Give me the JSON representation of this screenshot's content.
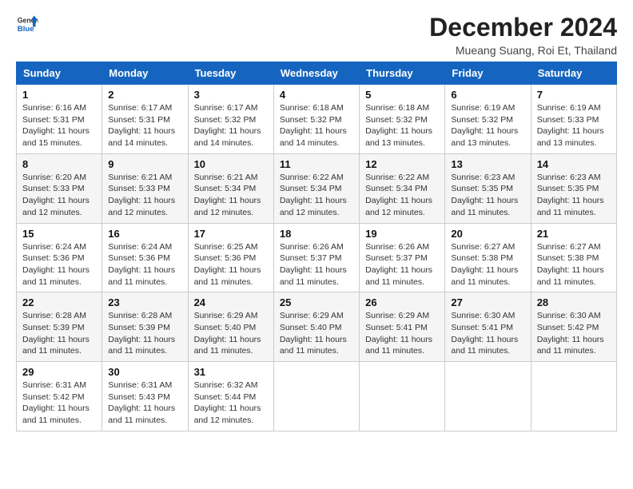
{
  "header": {
    "logo_general": "General",
    "logo_blue": "Blue",
    "title": "December 2024",
    "location": "Mueang Suang, Roi Et, Thailand"
  },
  "calendar": {
    "headers": [
      "Sunday",
      "Monday",
      "Tuesday",
      "Wednesday",
      "Thursday",
      "Friday",
      "Saturday"
    ],
    "weeks": [
      [
        {
          "day": "1",
          "sunrise": "6:16 AM",
          "sunset": "5:31 PM",
          "daylight": "11 hours and 15 minutes."
        },
        {
          "day": "2",
          "sunrise": "6:17 AM",
          "sunset": "5:31 PM",
          "daylight": "11 hours and 14 minutes."
        },
        {
          "day": "3",
          "sunrise": "6:17 AM",
          "sunset": "5:32 PM",
          "daylight": "11 hours and 14 minutes."
        },
        {
          "day": "4",
          "sunrise": "6:18 AM",
          "sunset": "5:32 PM",
          "daylight": "11 hours and 14 minutes."
        },
        {
          "day": "5",
          "sunrise": "6:18 AM",
          "sunset": "5:32 PM",
          "daylight": "11 hours and 13 minutes."
        },
        {
          "day": "6",
          "sunrise": "6:19 AM",
          "sunset": "5:32 PM",
          "daylight": "11 hours and 13 minutes."
        },
        {
          "day": "7",
          "sunrise": "6:19 AM",
          "sunset": "5:33 PM",
          "daylight": "11 hours and 13 minutes."
        }
      ],
      [
        {
          "day": "8",
          "sunrise": "6:20 AM",
          "sunset": "5:33 PM",
          "daylight": "11 hours and 12 minutes."
        },
        {
          "day": "9",
          "sunrise": "6:21 AM",
          "sunset": "5:33 PM",
          "daylight": "11 hours and 12 minutes."
        },
        {
          "day": "10",
          "sunrise": "6:21 AM",
          "sunset": "5:34 PM",
          "daylight": "11 hours and 12 minutes."
        },
        {
          "day": "11",
          "sunrise": "6:22 AM",
          "sunset": "5:34 PM",
          "daylight": "11 hours and 12 minutes."
        },
        {
          "day": "12",
          "sunrise": "6:22 AM",
          "sunset": "5:34 PM",
          "daylight": "11 hours and 12 minutes."
        },
        {
          "day": "13",
          "sunrise": "6:23 AM",
          "sunset": "5:35 PM",
          "daylight": "11 hours and 11 minutes."
        },
        {
          "day": "14",
          "sunrise": "6:23 AM",
          "sunset": "5:35 PM",
          "daylight": "11 hours and 11 minutes."
        }
      ],
      [
        {
          "day": "15",
          "sunrise": "6:24 AM",
          "sunset": "5:36 PM",
          "daylight": "11 hours and 11 minutes."
        },
        {
          "day": "16",
          "sunrise": "6:24 AM",
          "sunset": "5:36 PM",
          "daylight": "11 hours and 11 minutes."
        },
        {
          "day": "17",
          "sunrise": "6:25 AM",
          "sunset": "5:36 PM",
          "daylight": "11 hours and 11 minutes."
        },
        {
          "day": "18",
          "sunrise": "6:26 AM",
          "sunset": "5:37 PM",
          "daylight": "11 hours and 11 minutes."
        },
        {
          "day": "19",
          "sunrise": "6:26 AM",
          "sunset": "5:37 PM",
          "daylight": "11 hours and 11 minutes."
        },
        {
          "day": "20",
          "sunrise": "6:27 AM",
          "sunset": "5:38 PM",
          "daylight": "11 hours and 11 minutes."
        },
        {
          "day": "21",
          "sunrise": "6:27 AM",
          "sunset": "5:38 PM",
          "daylight": "11 hours and 11 minutes."
        }
      ],
      [
        {
          "day": "22",
          "sunrise": "6:28 AM",
          "sunset": "5:39 PM",
          "daylight": "11 hours and 11 minutes."
        },
        {
          "day": "23",
          "sunrise": "6:28 AM",
          "sunset": "5:39 PM",
          "daylight": "11 hours and 11 minutes."
        },
        {
          "day": "24",
          "sunrise": "6:29 AM",
          "sunset": "5:40 PM",
          "daylight": "11 hours and 11 minutes."
        },
        {
          "day": "25",
          "sunrise": "6:29 AM",
          "sunset": "5:40 PM",
          "daylight": "11 hours and 11 minutes."
        },
        {
          "day": "26",
          "sunrise": "6:29 AM",
          "sunset": "5:41 PM",
          "daylight": "11 hours and 11 minutes."
        },
        {
          "day": "27",
          "sunrise": "6:30 AM",
          "sunset": "5:41 PM",
          "daylight": "11 hours and 11 minutes."
        },
        {
          "day": "28",
          "sunrise": "6:30 AM",
          "sunset": "5:42 PM",
          "daylight": "11 hours and 11 minutes."
        }
      ],
      [
        {
          "day": "29",
          "sunrise": "6:31 AM",
          "sunset": "5:42 PM",
          "daylight": "11 hours and 11 minutes."
        },
        {
          "day": "30",
          "sunrise": "6:31 AM",
          "sunset": "5:43 PM",
          "daylight": "11 hours and 11 minutes."
        },
        {
          "day": "31",
          "sunrise": "6:32 AM",
          "sunset": "5:44 PM",
          "daylight": "11 hours and 12 minutes."
        },
        null,
        null,
        null,
        null
      ]
    ]
  }
}
